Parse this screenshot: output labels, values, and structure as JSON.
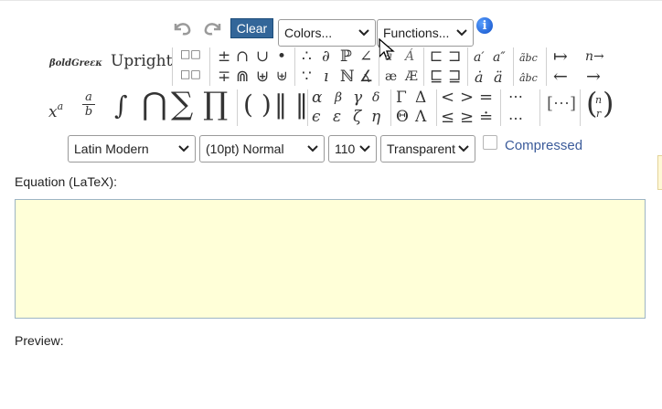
{
  "toolbar": {
    "clear_label": "Clear",
    "colors_select": "Colors...",
    "functions_select": "Functions...",
    "undo_icon": "undo-icon",
    "redo_icon": "redo-icon",
    "info_icon": "info-icon"
  },
  "styles": {
    "boldgreek": "βoldGreεκ",
    "upright": "Upright"
  },
  "math": {
    "box1": "□□",
    "box2": "□□",
    "pm": "±",
    "cap": "∩",
    "cup": "∪",
    "bullet": "•",
    "mp": "∓",
    "Cap": "⋒",
    "uplus": "⊎",
    "biguplus": "⊎",
    "therefore": "∴",
    "partial": "∂",
    "bbP": "ℙ",
    "angle": "∠",
    "because": "∵",
    "imath": "ı",
    "bbN": "ℕ",
    "measangle": "∡",
    "acute_a": "á",
    "A_acc": "Á",
    "ae": "æ",
    "AE": "Æ",
    "sqsubset": "⊏",
    "sqsupset": "⊐",
    "sqsubseteq": "⊑",
    "sqsupseteq": "⊒",
    "aprime": "a′",
    "adprime": "a″",
    "adot": "ȧ",
    "addot": "ä",
    "widetilde": "ãbc",
    "widehat": "âbc",
    "mapsto": "↦",
    "n_to": "n→",
    "leftarrow": "←",
    "rightarrow": "→",
    "xa_base": "x",
    "xa_sup": "a",
    "frac_num": "a",
    "frac_den": "b",
    "integral": "∫",
    "bigcap": "⋂",
    "sum": "∑",
    "prod": "∏",
    "parens": "( )",
    "norm": "‖ ‖",
    "alpha": "α",
    "beta": "β",
    "gamma": "γ",
    "delta": "δ",
    "epsilon": "ϵ",
    "varepsilon": "ε",
    "zeta": "ζ",
    "eta": "η",
    "Gamma": "Γ",
    "Delta": "Δ",
    "Theta": "Θ",
    "Lambda": "Λ",
    "lt": "<",
    "gt": ">",
    "eq": "=",
    "le": "≤",
    "ge": "≥",
    "doteq": "≐",
    "cdots": "⋯",
    "ldots": "…",
    "matrix": "[⋯]",
    "binom_n": "n",
    "binom_r": "r"
  },
  "options": {
    "font_select": "Latin Modern",
    "size_select": "(10pt) Normal",
    "dpi_select": "110",
    "bg_select": "Transparent",
    "compressed_label": "Compressed"
  },
  "equation_label": "Equation (LaTeX):",
  "preview_label": "Preview:",
  "colors": {
    "clear_bg": "#336699",
    "equation_bg": "#ffffd8",
    "compressed_text": "#3b5b9a"
  }
}
